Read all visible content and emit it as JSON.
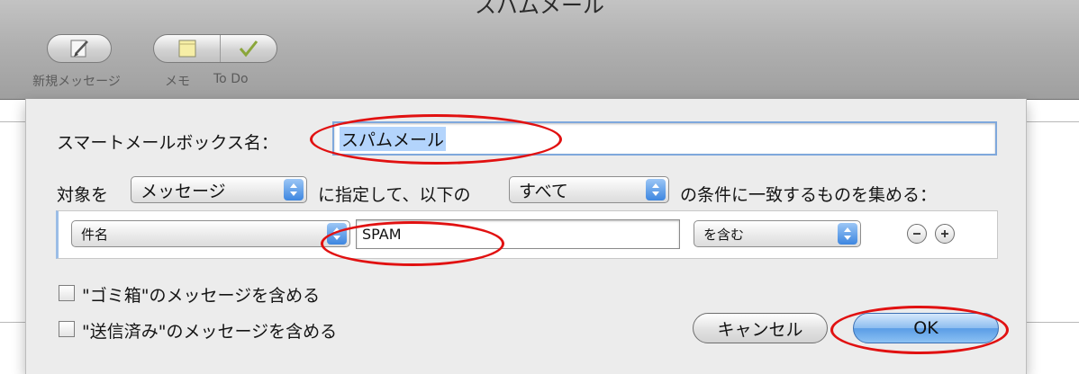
{
  "window": {
    "title": "スパムメール"
  },
  "toolbar": {
    "new_message_label": "新規メッセージ",
    "new_message_icon": "compose-icon",
    "note_label": "メモ",
    "note_icon": "note-icon",
    "todo_label": "To Do",
    "todo_icon": "checkmark-icon"
  },
  "dialog": {
    "name_label": "スマートメールボックス名：",
    "name_value": "スパムメール",
    "target_label": "対象を",
    "target_value": "メッセージ",
    "mid_label": "に指定して、以下の",
    "match_value": "すべて",
    "suffix_label": "の条件に一致するものを集める：",
    "condition": {
      "field_value": "件名",
      "text_value": "SPAM",
      "operator_value": "を含む",
      "remove_icon": "minus-icon",
      "add_icon": "plus-icon"
    },
    "include_trash_label": "\"ゴミ箱\"のメッセージを含める",
    "include_sent_label": "\"送信済み\"のメッセージを含める",
    "cancel_label": "キャンセル",
    "ok_label": "OK"
  },
  "colors": {
    "accent": "#3d86e0",
    "annotation": "#e11111",
    "selection": "#b3d4fc"
  }
}
